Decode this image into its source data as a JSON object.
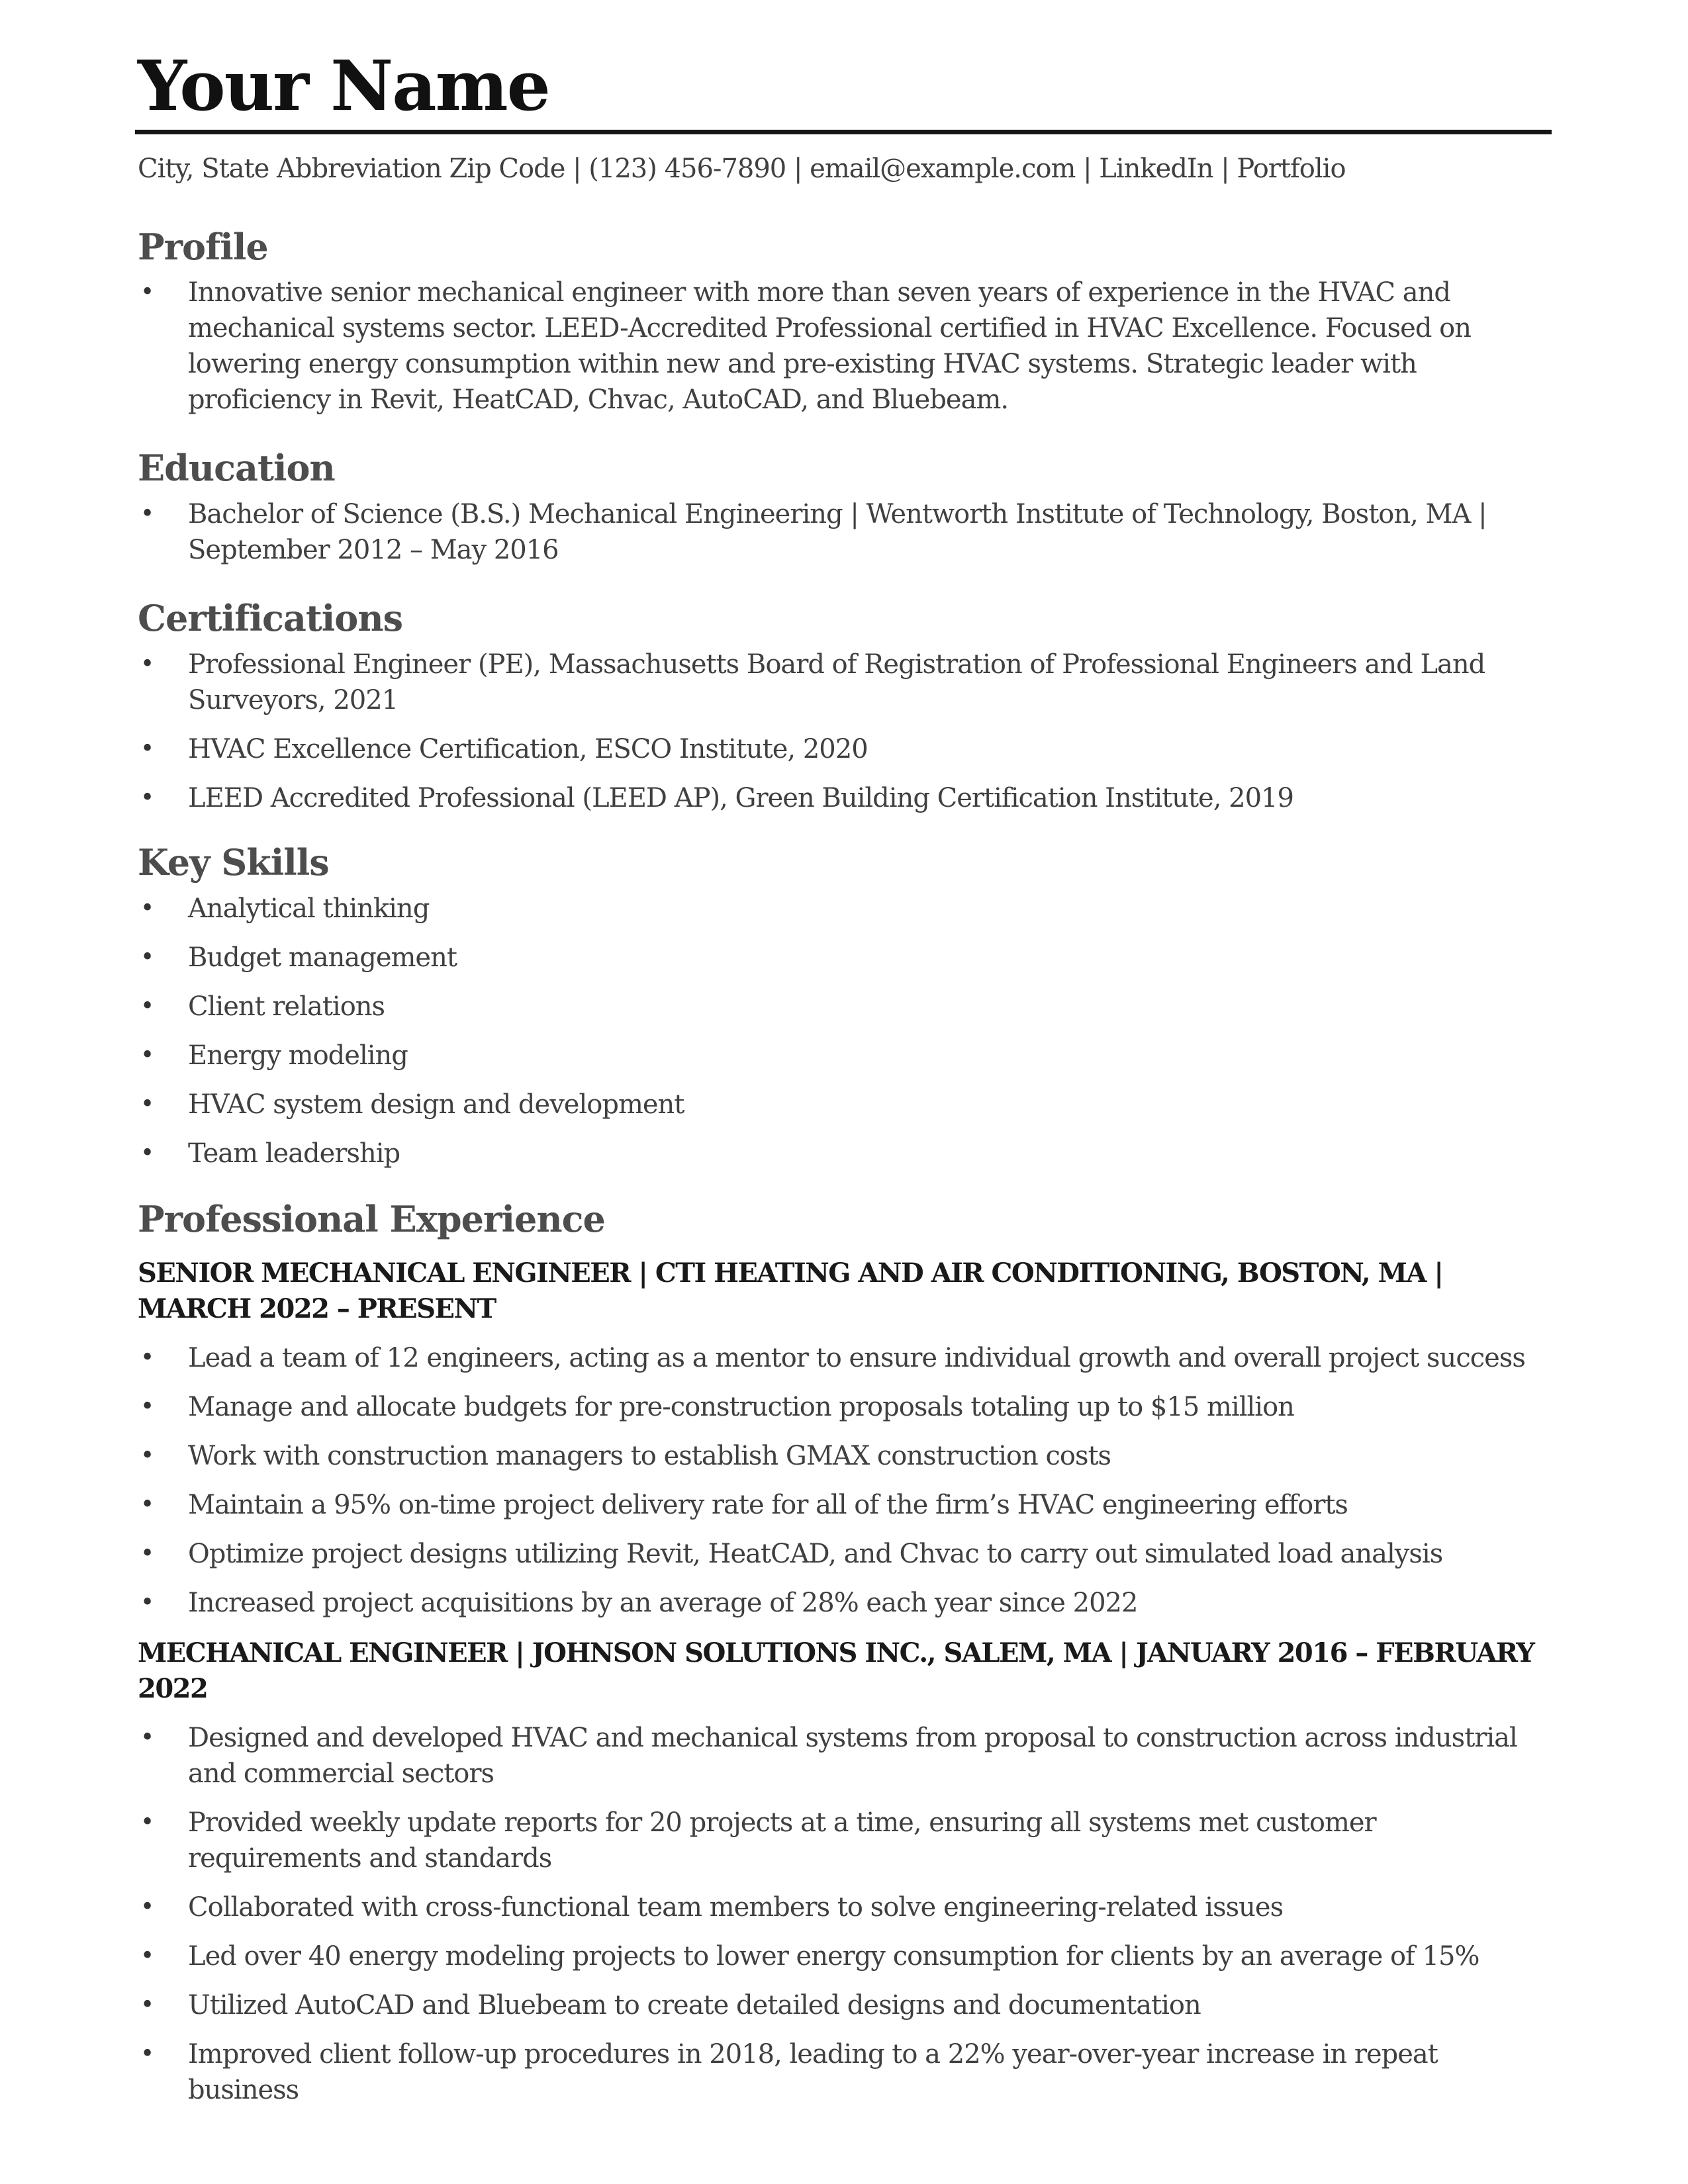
{
  "header": {
    "name": "Your Name",
    "contact": "City, State Abbreviation Zip Code | (123) 456-7890 | email@example.com | LinkedIn | Portfolio"
  },
  "sections": {
    "profile": {
      "title": "Profile",
      "items": [
        "Innovative senior mechanical engineer with more than seven years of experience in the HVAC and mechanical systems sector. LEED-Accredited Professional certified in HVAC Excellence. Focused on lowering energy consumption within new and pre-existing HVAC systems. Strategic leader with proficiency in Revit, HeatCAD, Chvac, AutoCAD, and Bluebeam."
      ]
    },
    "education": {
      "title": "Education",
      "items": [
        "Bachelor of Science (B.S.) Mechanical Engineering | Wentworth Institute of Technology, Boston, MA | September 2012 – May 2016"
      ]
    },
    "certifications": {
      "title": "Certifications",
      "items": [
        "Professional Engineer (PE), Massachusetts Board of Registration of Professional Engineers and Land Surveyors, 2021",
        "HVAC Excellence Certification, ESCO Institute, 2020",
        "LEED Accredited Professional (LEED AP), Green Building Certification Institute, 2019"
      ]
    },
    "skills": {
      "title": "Key Skills",
      "items": [
        "Analytical thinking",
        "Budget management",
        "Client relations",
        "Energy modeling",
        "HVAC system design and development",
        "Team leadership"
      ]
    },
    "experience": {
      "title": "Professional Experience",
      "jobs": [
        {
          "heading": "SENIOR MECHANICAL ENGINEER | CTI HEATING AND AIR CONDITIONING, BOSTON, MA | MARCH 2022 – PRESENT",
          "items": [
            "Lead a team of 12 engineers, acting as a mentor to ensure individual growth and overall project success",
            "Manage and allocate budgets for pre-construction proposals totaling up to $15 million",
            "Work with construction managers to establish GMAX construction costs",
            "Maintain a 95% on-time project delivery rate for all of the firm’s HVAC engineering efforts",
            "Optimize project designs utilizing Revit, HeatCAD, and Chvac to carry out simulated load analysis",
            "Increased project acquisitions by an average of 28% each year since 2022"
          ]
        },
        {
          "heading": "MECHANICAL ENGINEER | JOHNSON SOLUTIONS INC., SALEM, MA | JANUARY 2016 – FEBRUARY 2022",
          "items": [
            "Designed and developed HVAC and mechanical systems from proposal to construction across industrial and commercial sectors",
            "Provided weekly update reports for 20 projects at a time, ensuring all systems met customer requirements and standards",
            "Collaborated with cross-functional team members to solve engineering-related issues",
            "Led over 40 energy modeling projects to lower energy consumption for clients by an average of 15%",
            "Utilized AutoCAD and Bluebeam to create detailed designs and documentation",
            "Improved client follow-up procedures in 2018, leading to a 22% year-over-year increase in repeat business"
          ]
        }
      ]
    }
  },
  "bullet_glyph": "•"
}
